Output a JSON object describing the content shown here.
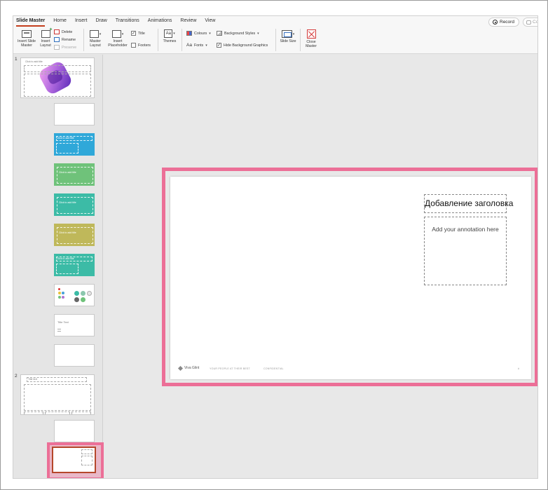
{
  "ribbon": {
    "tabs": [
      "Slide Master",
      "Home",
      "Insert",
      "Draw",
      "Transitions",
      "Animations",
      "Review",
      "View"
    ],
    "record_label": "Record",
    "comments_label": "Co",
    "insert_slide_master": "Insert Slide Master",
    "insert_layout": "Insert Layout",
    "delete": "Delete",
    "rename": "Rename",
    "preserve": "Preserve",
    "master_layout": "Master Layout",
    "insert_placeholder": "Insert Placeholder",
    "title_check": "Title",
    "footers_check": "Footers",
    "themes": "Themes",
    "colours": "Colours",
    "fonts": "Fonts",
    "fonts_icon_text": "Aa",
    "themes_icon_text": "Aa",
    "background_styles": "Background Styles",
    "hide_background_graphics": "Hide Background Graphics",
    "slide_size": "Slide Size",
    "close_master": "Close Master"
  },
  "thumbnails": {
    "master1_number": "1",
    "master2_number": "2",
    "placeholder_text": "Click to add title",
    "title_text_label": "Title Text",
    "master2_label": "Title text"
  },
  "colors": {
    "accent_pink": "#ec6f97",
    "blue_layout": "#2fa8d9",
    "green_layout": "#6fc27a",
    "teal_layout": "#3cbba6",
    "olive_layout": "#bfb85a",
    "tab_underline": "#c43e1c"
  },
  "slide": {
    "title": "Добавление заголовка",
    "body": "Add your annotation here",
    "logo_text": "Viva Glint",
    "footer_left": "YOUR PEOPLE AT THEIR BEST",
    "footer_mid": "CONFIDENTIAL",
    "page_no": "#"
  }
}
